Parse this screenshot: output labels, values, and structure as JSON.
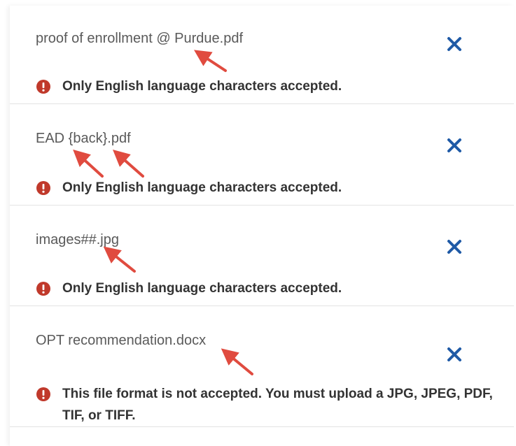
{
  "colors": {
    "remove_icon": "#1f5aa6",
    "error_icon": "#c0392b",
    "annotation_arrow": "#e04b3f"
  },
  "files": [
    {
      "name": "proof of enrollment @ Purdue.pdf",
      "error": "Only English language characters accepted.",
      "remove_icon": "close-icon",
      "error_icon": "exclamation-circle-icon"
    },
    {
      "name": "EAD {back}.pdf",
      "error": "Only English language characters accepted.",
      "remove_icon": "close-icon",
      "error_icon": "exclamation-circle-icon"
    },
    {
      "name": "images##.jpg",
      "error": "Only English language characters accepted.",
      "remove_icon": "close-icon",
      "error_icon": "exclamation-circle-icon"
    },
    {
      "name": "OPT recommendation.docx",
      "error": "This file format is not accepted. You must upload a JPG, JPEG, PDF, TIF, or TIFF.",
      "remove_icon": "close-icon",
      "error_icon": "exclamation-circle-icon"
    }
  ]
}
